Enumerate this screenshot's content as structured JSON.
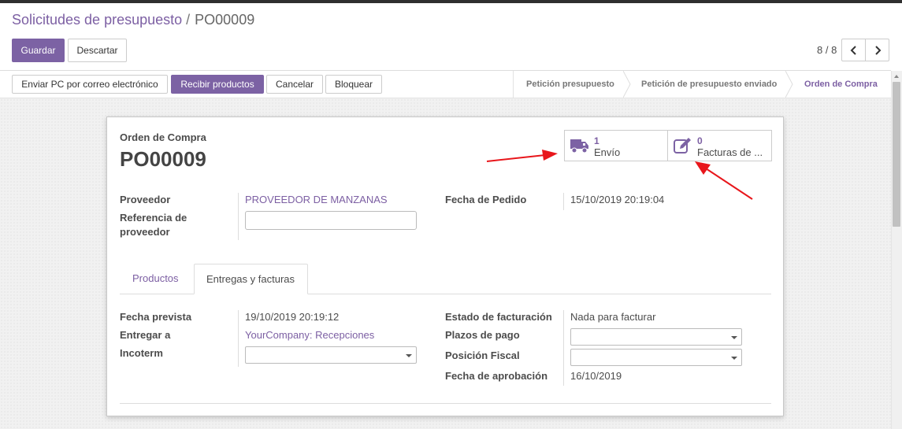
{
  "breadcrumb": {
    "parent": "Solicitudes de presupuesto",
    "separator": "/",
    "current": "PO00009"
  },
  "buttons": {
    "save": "Guardar",
    "discard": "Descartar"
  },
  "pager": {
    "value": "8 / 8",
    "prev_icon": "chevron-left-icon",
    "next_icon": "chevron-right-icon"
  },
  "actions": [
    {
      "label": "Enviar PC por correo electrónico"
    },
    {
      "label": "Recibir productos"
    },
    {
      "label": "Cancelar"
    },
    {
      "label": "Bloquear"
    }
  ],
  "statusbar": {
    "stages": [
      {
        "label": "Petición presupuesto"
      },
      {
        "label": "Petición de presupuesto enviado"
      },
      {
        "label": "Orden de Compra"
      }
    ],
    "current_index": 2
  },
  "sheet": {
    "doc_type": "Orden de Compra",
    "doc_name": "PO00009",
    "smart_buttons": [
      {
        "count": "1",
        "label": "Envío",
        "icon": "truck-icon"
      },
      {
        "count": "0",
        "label": "Facturas de ...",
        "icon": "edit-icon"
      }
    ],
    "fields_left": {
      "vendor_label": "Proveedor",
      "vendor_value": "PROVEEDOR DE MANZANAS",
      "vendor_ref_label": "Referencia de proveedor",
      "vendor_ref_value": ""
    },
    "fields_right": {
      "order_date_label": "Fecha de Pedido",
      "order_date_value": "15/10/2019 20:19:04"
    },
    "tabs": [
      {
        "label": "Productos"
      },
      {
        "label": "Entregas y facturas"
      }
    ],
    "deliveries": {
      "scheduled_date_label": "Fecha prevista",
      "scheduled_date_value": "19/10/2019 20:19:12",
      "deliver_to_label": "Entregar a",
      "deliver_to_value": "YourCompany: Recepciones",
      "incoterm_label": "Incoterm",
      "incoterm_value": "",
      "billing_status_label": "Estado de facturación",
      "billing_status_value": "Nada para facturar",
      "payment_terms_label": "Plazos de pago",
      "payment_terms_value": "",
      "fiscal_position_label": "Posición Fiscal",
      "fiscal_position_value": "",
      "approval_date_label": "Fecha de aprobación",
      "approval_date_value": "16/10/2019"
    }
  },
  "colors": {
    "primary": "#7c62a4",
    "link": "#7c5fa3",
    "annotation_arrow": "#e8161b"
  }
}
